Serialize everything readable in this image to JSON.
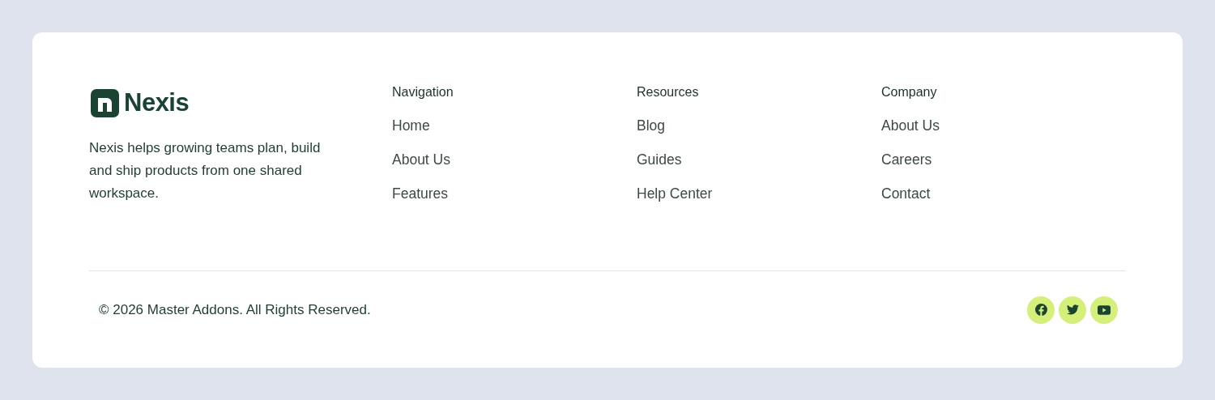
{
  "brand": {
    "name": "Nexis",
    "tagline": "Nexis helps growing teams plan, build and ship products from one shared workspace."
  },
  "columns": [
    {
      "heading": "Navigation",
      "links": [
        "Home",
        "About Us",
        "Features"
      ]
    },
    {
      "heading": "Resources",
      "links": [
        "Blog",
        "Guides",
        "Help Center"
      ]
    },
    {
      "heading": "Company",
      "links": [
        "About Us",
        "Careers",
        "Contact"
      ]
    }
  ],
  "copyright": "© 2026 Master Addons. All Rights Reserved."
}
